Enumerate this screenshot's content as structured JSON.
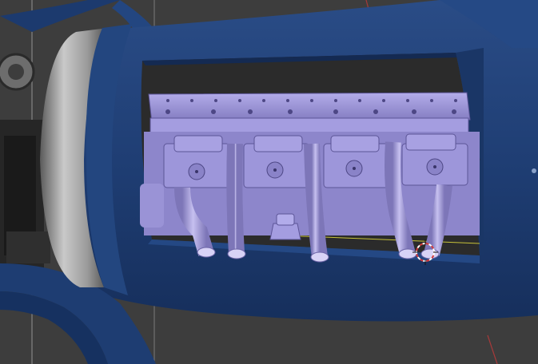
{
  "viewport": {
    "background_color": "#3d3d3d",
    "grid_line_color": "#4a4a4a",
    "axis_x_color": "#a63a3a"
  },
  "model": {
    "body_color": "#1e3c70",
    "body_shadow_color": "#142a52",
    "cowl_ring_color": "#9a9a9a",
    "engine_color": "#9f97d8",
    "engine_shadow_color": "#6d66a8",
    "pipe_color": "#a79fdf",
    "selection_edge_color": "#c7c23a",
    "cylinder_count": 4,
    "exhaust_pipe_count": 5
  },
  "cursor": {
    "icon": "3d-cursor-icon",
    "ring_colors": [
      "#d23a3a",
      "#ffffff"
    ]
  }
}
